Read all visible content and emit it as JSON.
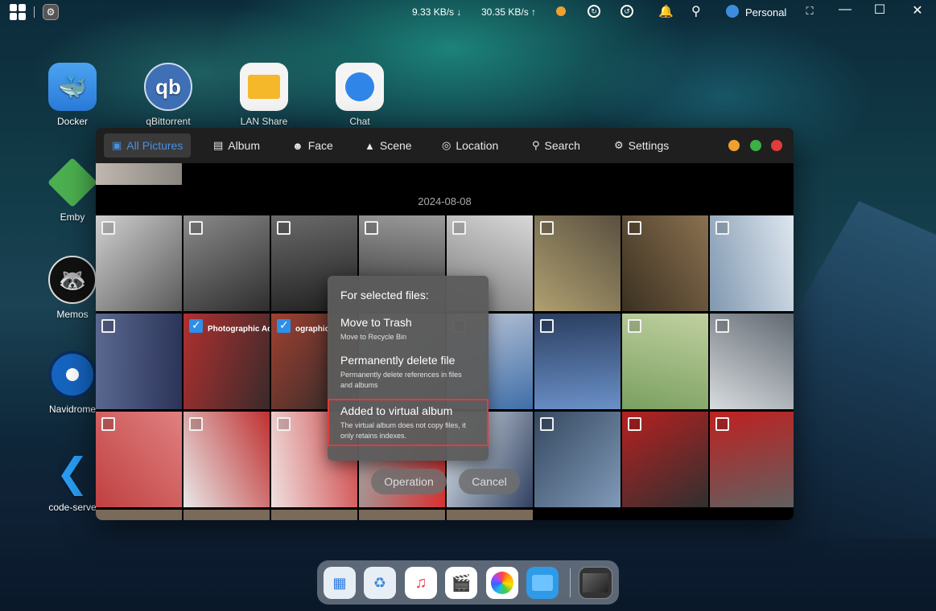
{
  "topbar": {
    "download_speed": "9.33 KB/s ↓",
    "upload_speed": "30.35 KB/s ↑",
    "user": "Personal"
  },
  "desktop": {
    "icons": [
      {
        "label": "Docker",
        "icon": "docker-whale-icon"
      },
      {
        "label": "qBittorrent",
        "icon": "qbittorrent-icon"
      },
      {
        "label": "LAN Share",
        "icon": "folder-share-icon"
      },
      {
        "label": "Chat",
        "icon": "chat-bubble-icon"
      },
      {
        "label": "Emby",
        "icon": "emby-play-icon"
      },
      {
        "label": "Memos",
        "icon": "memos-icon"
      },
      {
        "label": "Navidrome",
        "icon": "navidrome-disc-icon"
      },
      {
        "label": "code-serve",
        "icon": "vscode-icon"
      }
    ]
  },
  "window": {
    "tabs": [
      {
        "label": "All Pictures",
        "icon": "image-icon",
        "active": true
      },
      {
        "label": "Album",
        "icon": "album-icon"
      },
      {
        "label": "Face",
        "icon": "face-icon"
      },
      {
        "label": "Scene",
        "icon": "scene-icon"
      },
      {
        "label": "Location",
        "icon": "location-icon"
      },
      {
        "label": "Search",
        "icon": "search-icon"
      },
      {
        "label": "Settings",
        "icon": "gear-icon"
      }
    ],
    "controls": {
      "minimize_color": "#f0a030",
      "maximize_color": "#3cb043",
      "close_color": "#e03c3c"
    },
    "date_label": "2024-08-08",
    "photos": [
      {
        "checked": false
      },
      {
        "checked": false
      },
      {
        "checked": false
      },
      {
        "checked": false
      },
      {
        "checked": false
      },
      {
        "checked": false
      },
      {
        "checked": false
      },
      {
        "checked": false
      },
      {
        "checked": false
      },
      {
        "checked": true,
        "caption": "Photographic Accesso"
      },
      {
        "checked": true,
        "caption": "ographic"
      },
      {
        "checked": false
      },
      {
        "checked": false
      },
      {
        "checked": false
      },
      {
        "checked": false
      },
      {
        "checked": false
      },
      {
        "checked": false
      },
      {
        "checked": false
      },
      {
        "checked": false
      },
      {
        "checked": false
      },
      {
        "checked": false
      },
      {
        "checked": false
      },
      {
        "checked": false
      },
      {
        "checked": false
      }
    ]
  },
  "context_menu": {
    "heading": "For selected files:",
    "items": [
      {
        "title": "Move to Trash",
        "desc": "Move to Recycle Bin"
      },
      {
        "title": "Permanently delete file",
        "desc": "Permanently delete references in files and albums"
      },
      {
        "title": "Added to virtual album",
        "desc": "The virtual album does not copy files, it only retains indexes."
      }
    ]
  },
  "actions": {
    "operation": "Operation",
    "cancel": "Cancel"
  },
  "dock": {
    "items": [
      "apps-grid-icon",
      "trash-icon",
      "music-icon",
      "video-clapper-icon",
      "photos-icon",
      "files-folder-icon",
      "photo-app-preview-icon"
    ]
  },
  "colors": {
    "accent": "#4a90e2",
    "highlight_border": "#e43a3a"
  }
}
